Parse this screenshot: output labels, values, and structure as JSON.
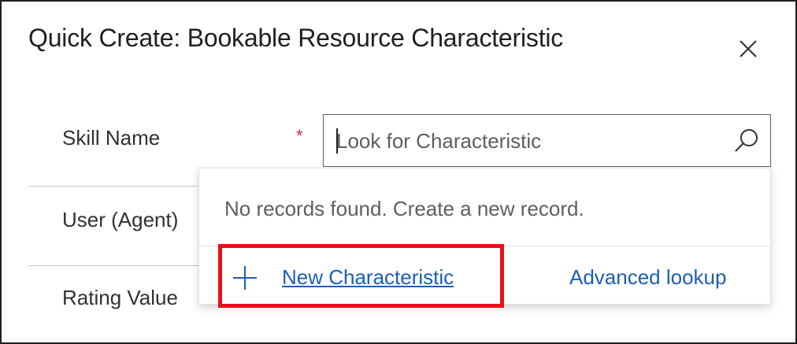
{
  "dialog": {
    "title": "Quick Create: Bookable Resource Characteristic",
    "close_icon": "close-icon"
  },
  "fields": {
    "skill_name": {
      "label": "Skill Name",
      "required_marker": "*",
      "placeholder": "Look for Characteristic",
      "value": ""
    },
    "user_agent": {
      "label": "User (Agent)"
    },
    "rating_value": {
      "label": "Rating Value"
    }
  },
  "lookup_dropdown": {
    "message": "No records found. Create a new record.",
    "new_record_label": "New Characteristic",
    "new_record_icon": "plus-icon",
    "advanced_lookup_label": "Advanced lookup",
    "search_icon": "search-icon"
  },
  "colors": {
    "link": "#1b5fb5",
    "required": "#c4314b",
    "highlight": "#e8101a"
  }
}
